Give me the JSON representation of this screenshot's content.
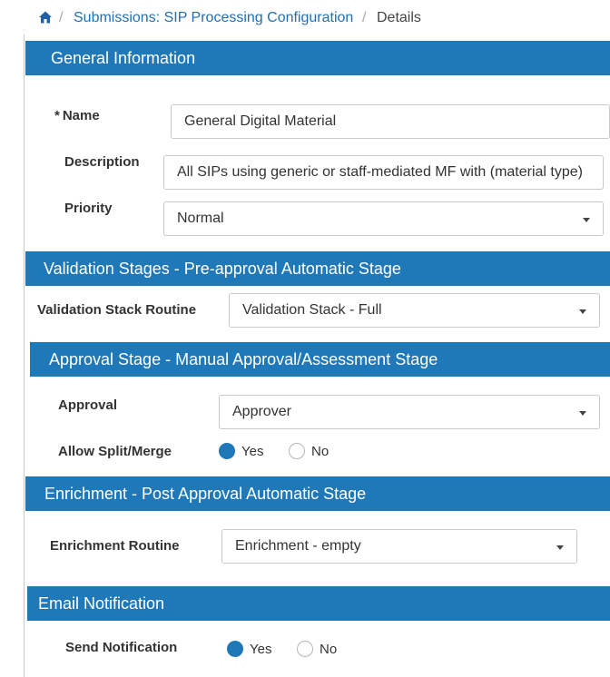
{
  "breadcrumb": {
    "home_icon": "home-icon",
    "items": [
      "Submissions: SIP Processing Configuration",
      "Details"
    ]
  },
  "sections": {
    "general": {
      "title": "General Information",
      "name_label": "Name",
      "name_required": "*",
      "name_value": "General Digital Material",
      "description_label": "Description",
      "description_value": "All SIPs using  generic or staff-mediated MF with (material type)",
      "priority_label": "Priority",
      "priority_value": "Normal"
    },
    "validation": {
      "title": "Validation Stages - Pre-approval Automatic Stage",
      "stack_label": "Validation Stack Routine",
      "stack_value": "Validation Stack - Full"
    },
    "approval": {
      "title": "Approval Stage - Manual Approval/Assessment Stage",
      "approval_label": "Approval",
      "approval_value": "Approver",
      "split_label": "Allow Split/Merge",
      "yes": "Yes",
      "no": "No",
      "split_selected": "Yes"
    },
    "enrichment": {
      "title": "Enrichment - Post Approval Automatic Stage",
      "routine_label": "Enrichment Routine",
      "routine_value": "Enrichment - empty"
    },
    "email": {
      "title": "Email Notification",
      "send_label": "Send Notification",
      "yes": "Yes",
      "no": "No",
      "send_selected": "Yes"
    }
  },
  "colors": {
    "section_header": "#1f78b8",
    "link": "#1f6fb5",
    "radio_selected": "#1f78b8"
  }
}
